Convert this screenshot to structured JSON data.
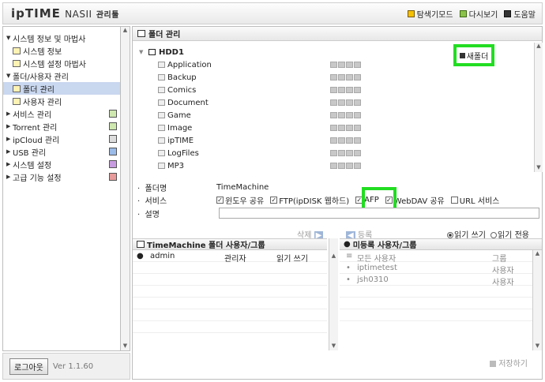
{
  "header": {
    "logo_brand": "ipTIME",
    "logo_product": "NASII",
    "logo_suffix": "관리툴",
    "nav": [
      "탐색기모드",
      "다시보기",
      "도움말"
    ]
  },
  "sidebar": {
    "items": [
      {
        "label": "시스템 정보 및 마법사",
        "level": 0,
        "expanded": true
      },
      {
        "label": "시스템 정보",
        "level": 1
      },
      {
        "label": "시스템 설정 마법사",
        "level": 1
      },
      {
        "label": "폴더/사용자 관리",
        "level": 0,
        "expanded": true
      },
      {
        "label": "폴더 관리",
        "level": 1,
        "selected": true
      },
      {
        "label": "사용자 관리",
        "level": 1
      },
      {
        "label": "서비스 관리",
        "level": 0
      },
      {
        "label": "Torrent 관리",
        "level": 0
      },
      {
        "label": "ipCloud 관리",
        "level": 0
      },
      {
        "label": "USB 관리",
        "level": 0
      },
      {
        "label": "시스템 설정",
        "level": 0
      },
      {
        "label": "고급 기능 설정",
        "level": 0
      }
    ],
    "logout_label": "로그아웃",
    "version": "Ver 1.1.60"
  },
  "main": {
    "title": "폴더 관리",
    "disk": "HDD1",
    "new_folder_label": "새폴더",
    "folders": [
      "Application",
      "Backup",
      "Comics",
      "Document",
      "Game",
      "Image",
      "ipTIME",
      "LogFiles",
      "MP3"
    ],
    "properties": {
      "folder_name_label": "폴더명",
      "folder_name_value": "TimeMachine",
      "services_label": "서비스",
      "services": [
        {
          "label": "윈도우 공유",
          "checked": true
        },
        {
          "label": "FTP(ipDISK 웹하드)",
          "checked": true
        },
        {
          "label": "AFP",
          "checked": true
        },
        {
          "label": "WebDAV 공유",
          "checked": true
        },
        {
          "label": "URL 서비스",
          "checked": false
        }
      ],
      "desc_label": "설명"
    },
    "delete_label": "삭제",
    "register_label": "등록",
    "access": {
      "read_write": "읽기 쓰기",
      "read_only": "읽기 전용",
      "selected": "read_write"
    },
    "assigned": {
      "title": "TimeMachine 폴더 사용자/그룹",
      "rows": [
        {
          "name": "admin",
          "role": "관리자",
          "perm": "읽기 쓰기"
        }
      ]
    },
    "unassigned": {
      "title": "미등록 사용자/그룹",
      "rows": [
        {
          "name": "모든 사용자",
          "type": "그룹"
        },
        {
          "name": "iptimetest",
          "type": "사용자"
        },
        {
          "name": "jsh0310",
          "type": "사용자"
        }
      ]
    },
    "save_label": "저장하기"
  }
}
